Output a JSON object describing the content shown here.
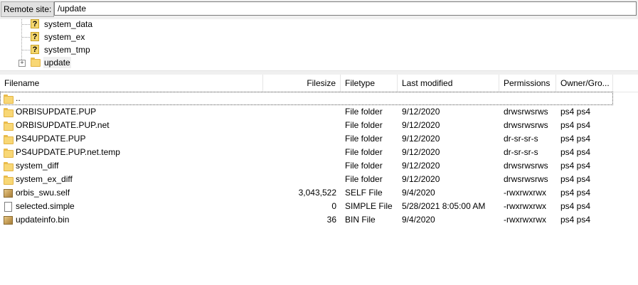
{
  "remote_site": {
    "label": "Remote site:",
    "path": "/update"
  },
  "tree": [
    {
      "label": "system_data",
      "icon": "question-folder-icon"
    },
    {
      "label": "system_ex",
      "icon": "question-folder-icon"
    },
    {
      "label": "system_tmp",
      "icon": "question-folder-icon"
    },
    {
      "label": "update",
      "icon": "folder-icon",
      "expander": "+"
    }
  ],
  "columns": {
    "filename": "Filename",
    "filesize": "Filesize",
    "filetype": "Filetype",
    "last_modified": "Last modified",
    "permissions": "Permissions",
    "owner_group": "Owner/Gro..."
  },
  "files": [
    {
      "name": "..",
      "icon": "folder",
      "size": "",
      "type": "",
      "modified": "",
      "permissions": "",
      "owner": ""
    },
    {
      "name": "ORBISUPDATE.PUP",
      "icon": "folder",
      "size": "",
      "type": "File folder",
      "modified": "9/12/2020",
      "permissions": "drwsrwsrws",
      "owner": "ps4 ps4"
    },
    {
      "name": "ORBISUPDATE.PUP.net",
      "icon": "folder",
      "size": "",
      "type": "File folder",
      "modified": "9/12/2020",
      "permissions": "drwsrwsrws",
      "owner": "ps4 ps4"
    },
    {
      "name": "PS4UPDATE.PUP",
      "icon": "folder",
      "size": "",
      "type": "File folder",
      "modified": "9/12/2020",
      "permissions": "dr-sr-sr-s",
      "owner": "ps4 ps4"
    },
    {
      "name": "PS4UPDATE.PUP.net.temp",
      "icon": "folder",
      "size": "",
      "type": "File folder",
      "modified": "9/12/2020",
      "permissions": "dr-sr-sr-s",
      "owner": "ps4 ps4"
    },
    {
      "name": "system_diff",
      "icon": "folder",
      "size": "",
      "type": "File folder",
      "modified": "9/12/2020",
      "permissions": "drwsrwsrws",
      "owner": "ps4 ps4"
    },
    {
      "name": "system_ex_diff",
      "icon": "folder",
      "size": "",
      "type": "File folder",
      "modified": "9/12/2020",
      "permissions": "drwsrwsrws",
      "owner": "ps4 ps4"
    },
    {
      "name": "orbis_swu.self",
      "icon": "package",
      "size": "3,043,522",
      "type": "SELF File",
      "modified": "9/4/2020",
      "permissions": "-rwxrwxrwx",
      "owner": "ps4 ps4"
    },
    {
      "name": "selected.simple",
      "icon": "document",
      "size": "0",
      "type": "SIMPLE File",
      "modified": "5/28/2021 8:05:00 AM",
      "permissions": "-rwxrwxrwx",
      "owner": "ps4 ps4"
    },
    {
      "name": "updateinfo.bin",
      "icon": "package",
      "size": "36",
      "type": "BIN File",
      "modified": "9/4/2020",
      "permissions": "-rwxrwxrwx",
      "owner": "ps4 ps4"
    }
  ]
}
